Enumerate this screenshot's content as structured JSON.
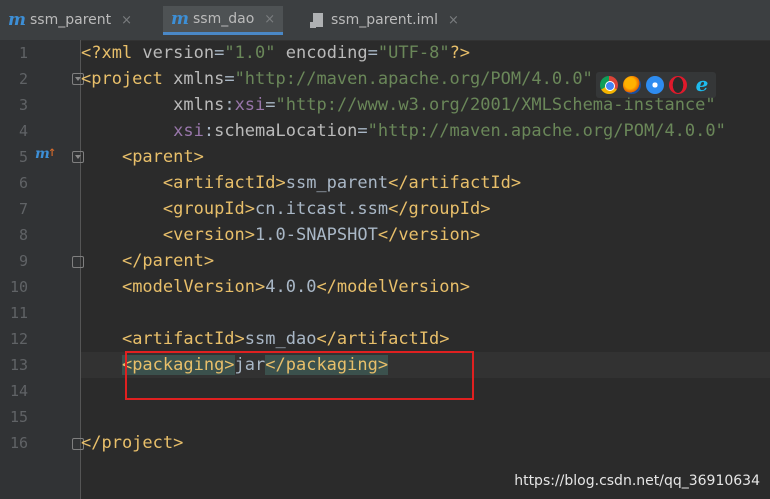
{
  "tabs": [
    {
      "icon": "m",
      "label": "ssm_parent",
      "close": "×",
      "active": false
    },
    {
      "icon": "m",
      "label": "ssm_dao",
      "close": "×",
      "active": true
    },
    {
      "icon": "file",
      "label": "ssm_parent.iml",
      "close": "×",
      "active": false
    }
  ],
  "line_numbers": [
    "1",
    "2",
    "3",
    "4",
    "5",
    "6",
    "7",
    "8",
    "9",
    "10",
    "11",
    "12",
    "13",
    "14",
    "15",
    "16"
  ],
  "gutter_marker": {
    "icon": "m",
    "arrow": "↑"
  },
  "code": {
    "l1": {
      "a": "<?xml ",
      "b": "version",
      "c": "=",
      "d": "\"1.0\"",
      "e": " ",
      "f": "encoding",
      "g": "=",
      "h": "\"UTF-8\"",
      "i": "?>"
    },
    "l2": {
      "a": "<project ",
      "b": "xmlns",
      "c": "=",
      "d": "\"http://maven.apache.org/POM/4.0.0\""
    },
    "l3": {
      "indent": "         ",
      "a": "xmlns",
      "b": ":",
      "c": "xsi",
      "d": "=",
      "e": "\"http://www.w3.org/2001/XMLSchema-instance\""
    },
    "l4": {
      "indent": "         ",
      "a": "xsi",
      "b": ":",
      "c": "schemaLocation",
      "d": "=",
      "e": "\"http://maven.apache.org/POM/4.0.0\""
    },
    "l5": {
      "indent": "    ",
      "a": "<parent>"
    },
    "l6": {
      "indent": "        ",
      "a": "<artifactId>",
      "b": "ssm_parent",
      "c": "</artifactId>"
    },
    "l7": {
      "indent": "        ",
      "a": "<groupId>",
      "b": "cn.itcast.ssm",
      "c": "</groupId>"
    },
    "l8": {
      "indent": "        ",
      "a": "<version>",
      "b": "1.0-SNAPSHOT",
      "c": "</version>"
    },
    "l9": {
      "indent": "    ",
      "a": "</parent>"
    },
    "l10": {
      "indent": "    ",
      "a": "<modelVersion>",
      "b": "4.0.0",
      "c": "</modelVersion>"
    },
    "l12": {
      "indent": "    ",
      "a": "<artifactId>",
      "b": "ssm_dao",
      "c": "</artifactId>"
    },
    "l13": {
      "indent": "    ",
      "a": "<packaging>",
      "b": "jar",
      "c": "</packaging>"
    },
    "l16": {
      "a": "</project>"
    }
  },
  "browser_icons": [
    "chrome-icon",
    "firefox-icon",
    "safari-icon",
    "opera-icon",
    "ie-icon"
  ],
  "watermark": "https://blog.csdn.net/qq_36910634",
  "colors": {
    "tag": "#E8BF6A",
    "attribute": "#BABABA",
    "namespace": "#9876AA",
    "string": "#6A8759",
    "text": "#A9B7C6",
    "highlight_box": "#E02020"
  }
}
